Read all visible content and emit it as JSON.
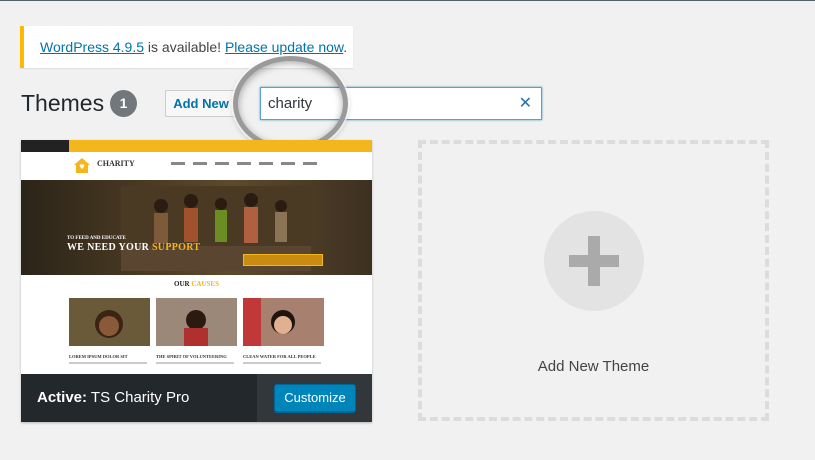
{
  "notice": {
    "link1": "WordPress 4.9.5",
    "mid": " is available! ",
    "link2": "Please update now",
    "end": "."
  },
  "header": {
    "title": "Themes",
    "count": "1",
    "add_new": "Add New"
  },
  "search": {
    "value": "charity",
    "clear_icon": "close-icon"
  },
  "active_theme": {
    "label_prefix": "Active:",
    "name": " TS Charity Pro",
    "customize": "Customize",
    "preview": {
      "logo": "CHARITY",
      "hero_small": "TO FEED AND EDUCATE",
      "hero_big": "WE NEED YOUR ",
      "hero_big_accent": "SUPPORT",
      "causes_title": "OUR ",
      "causes_accent": "CAUSES",
      "causes": [
        {
          "caption": "LOREM IPSUM DOLOR SIT"
        },
        {
          "caption": "THE SPIRIT OF VOLUNTEERING"
        },
        {
          "caption": "CLEAN WATER FOR ALL PEOPLE"
        }
      ]
    }
  },
  "add_theme": {
    "label": "Add New Theme",
    "icon": "plus-icon"
  },
  "colors": {
    "accent": "#0085ba",
    "notice_border": "#ffb900",
    "theme_yellow": "#f4b61d"
  }
}
